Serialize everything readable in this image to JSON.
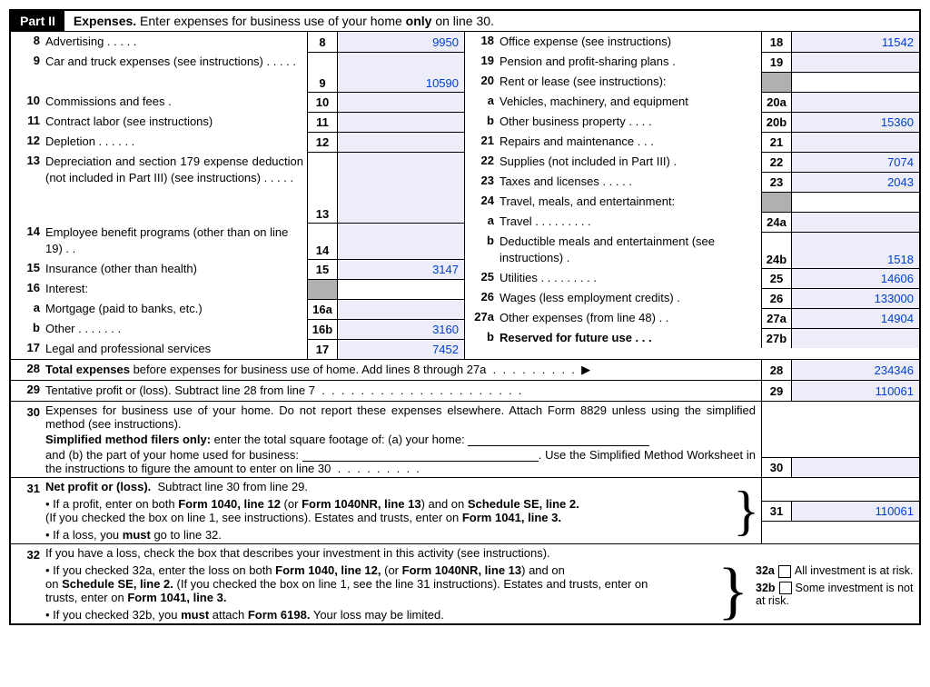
{
  "header": {
    "part": "Part II",
    "title_pre": "Expenses.",
    "title_post": " Enter expenses for business use of your home ",
    "title_bold": "only",
    "title_end": " on line 30."
  },
  "left": {
    "l8": {
      "n": "8",
      "label": "Advertising",
      "box": "8",
      "val": "9950"
    },
    "l9": {
      "n": "9",
      "label": "Car and truck expenses (see instructions)",
      "box": "9",
      "val": "10590"
    },
    "l10": {
      "n": "10",
      "label": "Commissions and fees",
      "box": "10",
      "val": ""
    },
    "l11": {
      "n": "11",
      "label": "Contract labor (see instructions)",
      "box": "11",
      "val": ""
    },
    "l12": {
      "n": "12",
      "label": "Depletion",
      "box": "12",
      "val": ""
    },
    "l13": {
      "n": "13",
      "label": "Depreciation and section 179 expense deduction (not included in Part III) (see instructions)",
      "box": "13",
      "val": ""
    },
    "l14": {
      "n": "14",
      "label": "Employee benefit programs (other than on line 19)",
      "box": "14",
      "val": ""
    },
    "l15": {
      "n": "15",
      "label": "Insurance (other than health)",
      "box": "15",
      "val": "3147"
    },
    "l16": {
      "n": "16",
      "label": "Interest:"
    },
    "l16a": {
      "n": "a",
      "label": "Mortgage (paid to banks, etc.)",
      "box": "16a",
      "val": ""
    },
    "l16b": {
      "n": "b",
      "label": "Other",
      "box": "16b",
      "val": "3160"
    },
    "l17": {
      "n": "17",
      "label": "Legal and professional services",
      "box": "17",
      "val": "7452"
    }
  },
  "right": {
    "l18": {
      "n": "18",
      "label": "Office expense (see instructions)",
      "box": "18",
      "val": "11542"
    },
    "l19": {
      "n": "19",
      "label": "Pension and profit-sharing plans",
      "box": "19",
      "val": ""
    },
    "l20": {
      "n": "20",
      "label": "Rent or lease (see instructions):"
    },
    "l20a": {
      "n": "a",
      "label": "Vehicles, machinery, and equipment",
      "box": "20a",
      "val": ""
    },
    "l20b": {
      "n": "b",
      "label": "Other business property",
      "box": "20b",
      "val": "15360"
    },
    "l21": {
      "n": "21",
      "label": "Repairs and maintenance",
      "box": "21",
      "val": ""
    },
    "l22": {
      "n": "22",
      "label": "Supplies (not included in Part III)",
      "box": "22",
      "val": "7074"
    },
    "l23": {
      "n": "23",
      "label": "Taxes and licenses",
      "box": "23",
      "val": "2043"
    },
    "l24": {
      "n": "24",
      "label": "Travel, meals, and entertainment:"
    },
    "l24a": {
      "n": "a",
      "label": "Travel",
      "box": "24a",
      "val": ""
    },
    "l24b": {
      "n": "b",
      "label": "Deductible meals and entertainment (see instructions)",
      "box": "24b",
      "val": "1518"
    },
    "l25": {
      "n": "25",
      "label": "Utilities",
      "box": "25",
      "val": "14606"
    },
    "l26": {
      "n": "26",
      "label": "Wages (less employment credits)",
      "box": "26",
      "val": "133000"
    },
    "l27a": {
      "n": "27a",
      "label": "Other expenses (from line 48)",
      "box": "27a",
      "val": "14904"
    },
    "l27b": {
      "n": "b",
      "label": "Reserved for future use",
      "box": "27b",
      "val": ""
    }
  },
  "bottom": {
    "l28": {
      "n": "28",
      "label": "Total expenses before expenses for business use of home. Add lines 8 through 27a",
      "box": "28",
      "val": "234346"
    },
    "l29": {
      "n": "29",
      "label": "Tentative profit or (loss). Subtract line 28 from line 7",
      "box": "29",
      "val": "110061"
    },
    "l30": {
      "n": "30",
      "p1": "Expenses for business use of your home. Do not report these expenses elsewhere. Attach Form 8829 unless using the simplified method (see instructions).",
      "p2a": "Simplified method filers only:",
      "p2b": " enter the total square footage of: (a) your home: ",
      "p3a": "and (b) the part of your home used for business: ",
      "p3b": ". Use the Simplified Method Worksheet in the instructions to figure the amount to enter on line 30",
      "box": "30",
      "val": ""
    },
    "l31": {
      "n": "31",
      "head": "Net profit or (loss).  Subtract line 30 from line 29.",
      "b1a": "If a profit, enter on both ",
      "b1b": "Form 1040, line 12",
      "b1c": " (or ",
      "b1d": "Form 1040NR, line 13",
      "b1e": ") and on ",
      "b1f": "Schedule SE, line 2.",
      "b1g": " (If you checked the box on line 1, see instructions). Estates and trusts, enter on ",
      "b1h": "Form 1041, line 3.",
      "b2a": "If a loss, you ",
      "b2b": "must",
      "b2c": "  go to line 32.",
      "box": "31",
      "val": "110061"
    },
    "l32": {
      "n": "32",
      "head": "If you have a loss, check the box that describes your investment in this activity (see instructions).",
      "b1a": "If you checked 32a, enter the loss on both ",
      "b1b": "Form 1040, line 12,",
      "b1c": " (or ",
      "b1d": "Form 1040NR, line 13",
      "b1e": ") and on ",
      "b1f": "Schedule SE, line 2.",
      "b1g": " (If you checked the box on line 1, see the line 31 instructions). Estates and trusts, enter on ",
      "b1h": "Form 1041, line 3.",
      "b2a": "If you checked 32b, you ",
      "b2b": "must",
      "b2c": " attach ",
      "b2d": "Form 6198.",
      "b2e": " Your loss may be limited.",
      "opt_a": {
        "box": "32a",
        "label": "All investment is at risk."
      },
      "opt_b": {
        "box": "32b",
        "label": "Some investment is not at risk."
      }
    }
  }
}
